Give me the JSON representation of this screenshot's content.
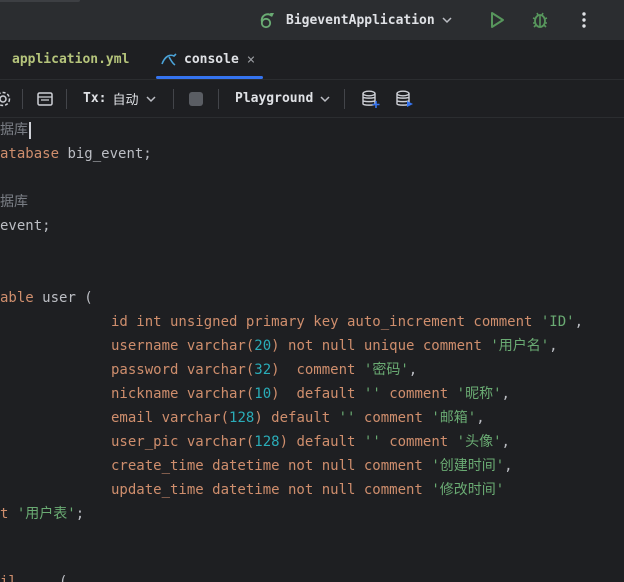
{
  "titlebar": {
    "run_config": "BigeventApplication"
  },
  "tabs": [
    {
      "label": "application.yml"
    },
    {
      "label": "console",
      "close": "×"
    }
  ],
  "toolbar": {
    "tx_label": "Tx:",
    "tx_value": "自动",
    "playground_label": "Playground"
  },
  "editor": {
    "lines": [
      [
        "据库"
      ],
      [
        "atabase",
        "big_event;"
      ],
      [],
      [
        "据库"
      ],
      [
        "event;"
      ],
      [],
      [],
      [
        "able",
        "user ("
      ],
      [
        "id int unsigned primary key auto_increment comment",
        "'ID'",
        ","
      ],
      [
        "username varchar(",
        "20",
        ") not null unique comment",
        "'用户名'",
        ","
      ],
      [
        "password varchar(",
        "32",
        ")  comment",
        "'密码'",
        ","
      ],
      [
        "nickname varchar(",
        "10",
        ")  default",
        "''",
        "comment",
        "'昵称'",
        ","
      ],
      [
        "email varchar(",
        "128",
        ") default",
        "''",
        "comment",
        "'邮箱'",
        ","
      ],
      [
        "user_pic varchar(",
        "128",
        ") default",
        "''",
        "comment",
        "'头像'",
        ","
      ],
      [
        "create_time datetime not null comment",
        "'创建时间'",
        ","
      ],
      [
        "update_time datetime not null comment",
        "'修改时间'"
      ],
      [
        "t",
        "'用户表'",
        ";"
      ],
      [],
      [],
      [
        "il",
        "...",
        "("
      ]
    ]
  },
  "colors": {
    "keyword": "#cf8e6d",
    "string": "#6aab73",
    "number": "#2aacb8",
    "accent": "#3574f0"
  }
}
